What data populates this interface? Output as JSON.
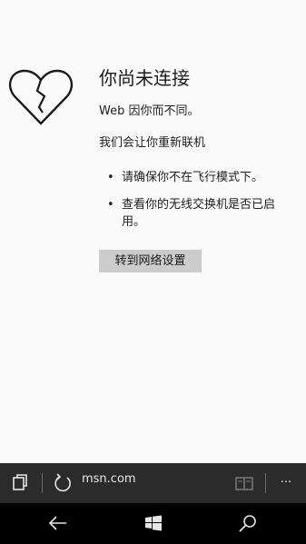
{
  "error": {
    "title": "你尚未连接",
    "subtitle": "Web 因你而不同。",
    "reconnect": "我们会让你重新联机",
    "tips": [
      "请确保你不在飞行模式下。",
      "查看你的无线交换机是否已启用。"
    ],
    "bullet": "•",
    "button_label": "转到网络设置",
    "icon": "broken-heart-icon"
  },
  "address_bar": {
    "url": "msn.com",
    "icons": [
      "tabs-icon",
      "refresh-icon",
      "reading-view-icon",
      "more-icon"
    ],
    "more_label": "···"
  },
  "nav_bar": {
    "icons": [
      "back-arrow-icon",
      "windows-start-icon",
      "search-icon"
    ]
  },
  "colors": {
    "page_background": "#fafafa",
    "button_background": "#cccccc",
    "address_bar": "#2b2b2b",
    "nav_bar": "#000000"
  }
}
